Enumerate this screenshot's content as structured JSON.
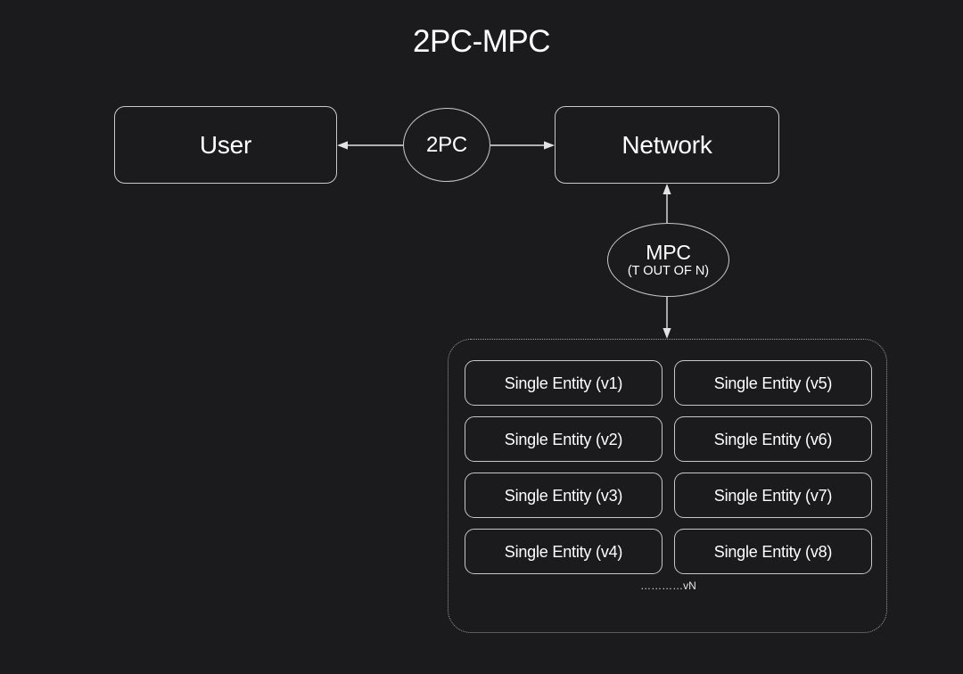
{
  "diagram": {
    "title": "2PC-MPC",
    "background_color": "#1b1b1d",
    "stroke_color": "#c9c9cc",
    "text_color": "#ffffff"
  },
  "nodes": {
    "user": {
      "label": "User"
    },
    "network": {
      "label": "Network"
    },
    "twopc": {
      "label": "2PC"
    },
    "mpc": {
      "label": "MPC",
      "sublabel": "(T OUT OF N)"
    }
  },
  "edges": [
    {
      "from": "2PC",
      "to": "User",
      "direction": "left",
      "style": "solid"
    },
    {
      "from": "2PC",
      "to": "Network",
      "direction": "right",
      "style": "solid"
    },
    {
      "from": "MPC",
      "to": "Network",
      "direction": "up",
      "style": "solid"
    },
    {
      "from": "MPC",
      "to": "Entities",
      "direction": "down",
      "style": "solid"
    }
  ],
  "entities_container": {
    "border_style": "dotted",
    "rows": [
      {
        "left": "Single Entity (v1)",
        "right": "Single Entity (v5)"
      },
      {
        "left": "Single Entity (v2)",
        "right": "Single Entity (v6)"
      },
      {
        "left": "Single Entity (v3)",
        "right": "Single Entity (v7)"
      },
      {
        "left": "Single Entity (v4)",
        "right": "Single Entity (v8)"
      }
    ],
    "more_label": "…………vN"
  }
}
